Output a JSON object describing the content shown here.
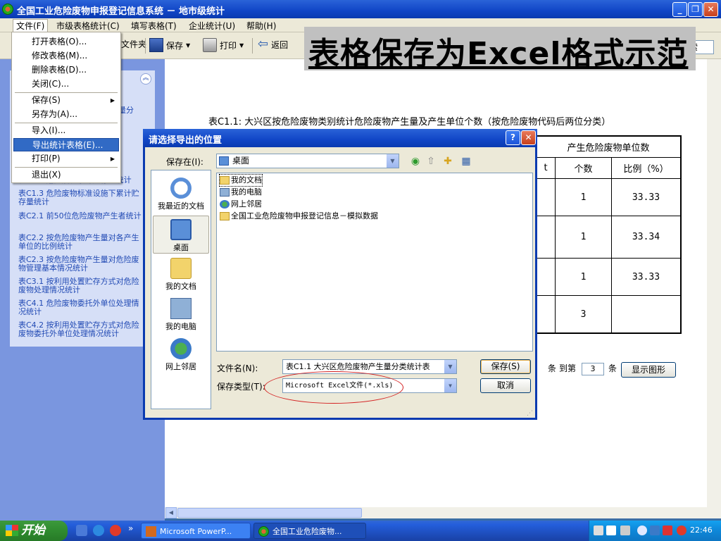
{
  "window": {
    "title": "全国工业危险废物申报登记信息系统 － 地市级统计",
    "min": "_",
    "restore": "❐",
    "close": "✕"
  },
  "menubar": [
    "文件(F)",
    "市级表格统计(C)",
    "填写表格(T)",
    "企业统计(U)",
    "帮助(H)"
  ],
  "toolbar": {
    "folder_fragment": "文件夹",
    "save": "保存",
    "print": "打印",
    "back": "返回",
    "search_fragment": "索"
  },
  "banner": "表格保存为Excel格式示范",
  "file_menu": {
    "items": [
      {
        "label": "打开表格(O)..."
      },
      {
        "label": "修改表格(M)..."
      },
      {
        "label": "删除表格(D)..."
      },
      {
        "label": "关闭(C)..."
      },
      {
        "label": "保存(S)",
        "submenu": true
      },
      {
        "label": "另存为(A)..."
      },
      {
        "label": "导入(I)..."
      },
      {
        "label": "导出统计表格(E)...",
        "highlighted": true
      },
      {
        "label": "打印(P)",
        "submenu": true
      },
      {
        "label": "退出(X)"
      }
    ]
  },
  "left_panel": {
    "collapse_icon": "︽",
    "fragment": "量分",
    "links": [
      "表C1.2 危险废物累计贮存量统计",
      "表C1.3 危险废物标准设施下累计贮存量统计",
      "表C2.1 前50位危险废物产生者统计",
      "表C2.2 按危险废物产生量对各产生单位的比例统计",
      "表C2.3 按危险废物产生量对危险废物管理基本情况统计",
      "表C3.1 按利用处置贮存方式对危险废物处理情况统计",
      "表C4.1 危险废物委托外单位处理情况统计",
      "表C4.2 按利用处置贮存方式对危险废物委托外单位处理情况统计"
    ]
  },
  "report": {
    "title": "表C1.1: 大兴区按危险废物类别统计危险废物产生量及产生单位个数（按危险废物代码后两位分类）",
    "group_header": "产生危险废物单位数",
    "col_headers": [
      "个数",
      "比例（%）"
    ],
    "clipped_cell": "t",
    "rows": [
      [
        "1",
        "33.33"
      ],
      [
        "1",
        "33.34"
      ],
      [
        "1",
        "33.33"
      ],
      [
        "3",
        ""
      ]
    ],
    "pager": {
      "tiao": "条",
      "to": "到第",
      "to_value": "3",
      "tiao2": "条",
      "show_chart": "显示图形"
    }
  },
  "dialog": {
    "title": "请选择导出的位置",
    "help": "?",
    "close": "✕",
    "save_in_label": "保存在(I):",
    "save_in_value": "桌面",
    "places": [
      "我最近的文档",
      "桌面",
      "我的文档",
      "我的电脑",
      "网上邻居"
    ],
    "files": [
      {
        "name": "我的文档",
        "icon": "folder-icon"
      },
      {
        "name": "我的电脑",
        "icon": "computer-icon"
      },
      {
        "name": "网上邻居",
        "icon": "network-icon"
      },
      {
        "name": "全国工业危险废物申报登记信息－模拟数据",
        "icon": "folder-icon"
      }
    ],
    "filename_label": "文件名(N):",
    "filename_value": "表C1.1 大兴区危险废物产生量分类统计表",
    "filetype_label": "保存类型(T):",
    "filetype_value": "Microsoft Excel文件(*.xls)",
    "save_button": "保存(S)",
    "cancel_button": "取消",
    "grip": "⋰"
  },
  "taskbar": {
    "start": "开始",
    "overflow": "»",
    "tasks": [
      "Microsoft PowerP...",
      "全国工业危险废物..."
    ],
    "clock": "22:46"
  }
}
